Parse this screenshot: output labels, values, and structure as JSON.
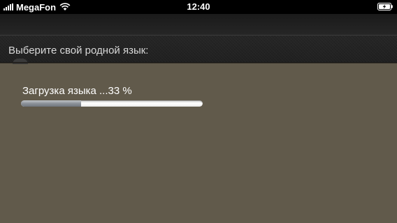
{
  "status_bar": {
    "carrier": "MegaFon",
    "time": "12:40",
    "signal_bars": 5,
    "wifi_icon": "wifi-icon",
    "battery_icon": "battery-charging-icon"
  },
  "header": {
    "prompt": "Выберите свой родной язык:"
  },
  "loading": {
    "label": "Загрузка языка ...33 %",
    "progress_percent": 33
  },
  "colors": {
    "background": "#615a4b",
    "header": "#222222",
    "status_bar": "#000000"
  }
}
